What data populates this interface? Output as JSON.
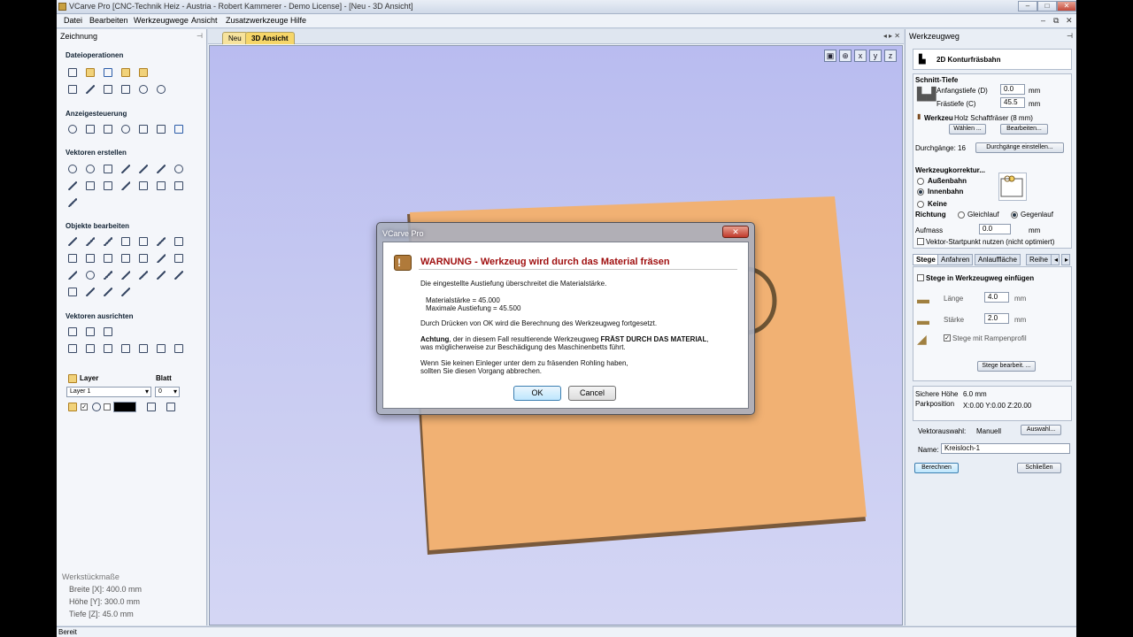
{
  "window": {
    "title": "VCarve Pro [CNC-Technik Heiz - Austria - Robert Kammerer - Demo License] - [Neu - 3D Ansicht]"
  },
  "menu": [
    "Datei",
    "Bearbeiten",
    "Werkzeugwege",
    "Ansicht",
    "Zusatzwerkzeuge",
    "Hilfe"
  ],
  "left": {
    "header": "Zeichnung",
    "sections": [
      "Dateioperationen",
      "Anzeigesteuerung",
      "Vektoren erstellen",
      "Objekte bearbeiten",
      "Vektoren ausrichten"
    ],
    "layer_label": "Layer",
    "blatt_label": "Blatt",
    "layer_value": "Layer 1",
    "blatt_value": "0",
    "werk_title": "Werkstückmaße",
    "breite": "Breite [X]: 400.0 mm",
    "hoehe": "Höhe   [Y]: 300.0 mm",
    "tiefe": "Tiefe  [Z]: 45.0 mm"
  },
  "tabs": {
    "neu": "Neu",
    "ansicht": "3D Ansicht",
    "nav": "◂ ▸ ✕"
  },
  "dialog": {
    "title": "VCarve Pro",
    "heading": "WARNUNG - Werkzeug wird durch das Material fräsen",
    "line1": "Die eingestellte Austiefung überschreitet die Materialstärke.",
    "material": "Materialstärke = 45.000",
    "austiefung": "Maximale Austiefung = 45.500",
    "line2": "Durch Drücken von OK wird die Berechnung des Werkzeugweg fortgesetzt.",
    "achtung_bold": "Achtung",
    "achtung_text": ", der in diesem Fall resultierende Werkzeugweg ",
    "achtung_bold2": "FRÄST DURCH DAS MATERIAL",
    "achtung_text2": ",",
    "achtung_line2": "was möglicherweise zur Beschädigung des Maschinenbetts führt.",
    "hint1": "Wenn Sie keinen Einleger unter dem zu fräsenden Rohling haben,",
    "hint2": "sollten Sie diesen Vorgang abbrechen.",
    "ok": "OK",
    "cancel": "Cancel",
    "close": "✕"
  },
  "right": {
    "header": "Werkzeugweg",
    "title": "2D Konturfräsbahn",
    "schnitt": "Schnitt-Tiefe",
    "anfang_label": "Anfangstiefe (D)",
    "anfang_value": "0.0",
    "anfang_unit": "mm",
    "fraes_label": "Frästiefe (C)",
    "fraes_value": "45.5",
    "fraes_unit": "mm",
    "werkzeug_label": "Werkzeu",
    "werkzeug_value": "Holz Schaftfräser (8 mm)",
    "waehlen": "Wählen ...",
    "bearbeiten": "Bearbeiten...",
    "durchgaenge": "Durchgänge: 16",
    "durchgaenge_btn": "Durchgänge einstellen...",
    "korrektur": "Werkzeugkorrektur...",
    "aussen": "Außenbahn",
    "innen": "Innenbahn",
    "keine": "Keine",
    "richtung": "Richtung",
    "gleich": "Gleichlauf",
    "gegen": "Gegenlauf",
    "aufmass": "Aufmass",
    "aufmass_value": "0.0",
    "aufmass_unit": "mm",
    "vektor_start": "Vektor-Startpunkt nutzen (nicht optimiert)",
    "tabs": [
      "Stege",
      "Anfahren",
      "Anlauffläche",
      "Reihe"
    ],
    "stege_einfuegen": "Stege in Werkzeugweg einfügen",
    "laenge": "Länge",
    "laenge_value": "4.0",
    "staerke": "Stärke",
    "staerke_value": "2.0",
    "unit": "mm",
    "rampe": "Stege mit Rampenprofil",
    "stege_bearbeit": "Stege bearbeit. ...",
    "sichere": "Sichere Höhe",
    "sichere_value": "6.0 mm",
    "park": "Parkposition",
    "park_value": "X:0.00 Y:0.00 Z:20.00",
    "vektorauswahl": "Vektorauswahl:",
    "manuell": "Manuell",
    "auswahl": "Auswahl...",
    "name_label": "Name:",
    "name_value": "Kreisloch-1",
    "berechnen": "Berechnen",
    "schliessen": "Schließen"
  },
  "status": "Bereit",
  "colors": {
    "board": "#f2b072",
    "warning": "#a01010",
    "viewport_top": "#b9bcf0"
  }
}
